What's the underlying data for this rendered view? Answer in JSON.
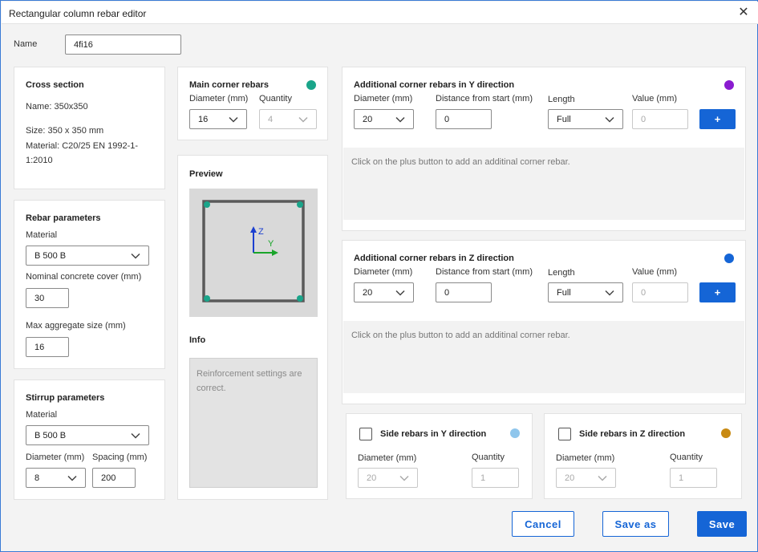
{
  "window": {
    "title": "Rectangular column rebar editor"
  },
  "name_field": {
    "label": "Name",
    "value": "4fi16"
  },
  "cross_section": {
    "heading": "Cross section",
    "name_line": "Name: 350x350",
    "size_line": "Size: 350 x 350 mm",
    "material_line1": "Material: C20/25 EN 1992-1-",
    "material_line2": "1:2010"
  },
  "rebar_params": {
    "heading": "Rebar parameters",
    "material_label": "Material",
    "material_value": "B 500 B",
    "cover_label": "Nominal concrete cover (mm)",
    "cover_value": "30",
    "aggregate_label": "Max aggregate size (mm)",
    "aggregate_value": "16"
  },
  "stirrup_params": {
    "heading": "Stirrup parameters",
    "material_label": "Material",
    "material_value": "B 500 B",
    "diameter_label": "Diameter (mm)",
    "diameter_value": "8",
    "spacing_label": "Spacing (mm)",
    "spacing_value": "200"
  },
  "main_corner": {
    "heading": "Main corner rebars",
    "diameter_label": "Diameter (mm)",
    "diameter_value": "16",
    "quantity_label": "Quantity",
    "quantity_value": "4",
    "color": "#1aa58a"
  },
  "preview": {
    "heading": "Preview",
    "axis_z": "Z",
    "axis_y": "Y"
  },
  "info": {
    "heading": "Info",
    "message": "Reinforcement settings are correct."
  },
  "add_y": {
    "heading": "Additional corner rebars in Y direction",
    "diameter_label": "Diameter (mm)",
    "diameter_value": "20",
    "distance_label": "Distance from start (mm)",
    "distance_value": "0",
    "length_label": "Length",
    "length_value": "Full",
    "value_label": "Value (mm)",
    "value_placeholder": "0",
    "plus_label": "+",
    "hint": "Click on the plus button to add an additinal corner rebar.",
    "color": "#8a1bd0"
  },
  "add_z": {
    "heading": "Additional corner rebars in Z direction",
    "diameter_label": "Diameter (mm)",
    "diameter_value": "20",
    "distance_label": "Distance from start (mm)",
    "distance_value": "0",
    "length_label": "Length",
    "length_value": "Full",
    "value_label": "Value (mm)",
    "value_placeholder": "0",
    "plus_label": "+",
    "hint": "Click on the plus button to add an additinal corner rebar.",
    "color": "#1565d6"
  },
  "side_y": {
    "heading": "Side rebars in Y direction",
    "diameter_label": "Diameter (mm)",
    "diameter_value": "20",
    "quantity_label": "Quantity",
    "quantity_value": "1",
    "color": "#8fc6ec"
  },
  "side_z": {
    "heading": "Side rebars in Z direction",
    "diameter_label": "Diameter (mm)",
    "diameter_value": "20",
    "quantity_label": "Quantity",
    "quantity_value": "1",
    "color": "#c88a12"
  },
  "footer": {
    "cancel": "Cancel",
    "save_as": "Save as",
    "save": "Save"
  }
}
